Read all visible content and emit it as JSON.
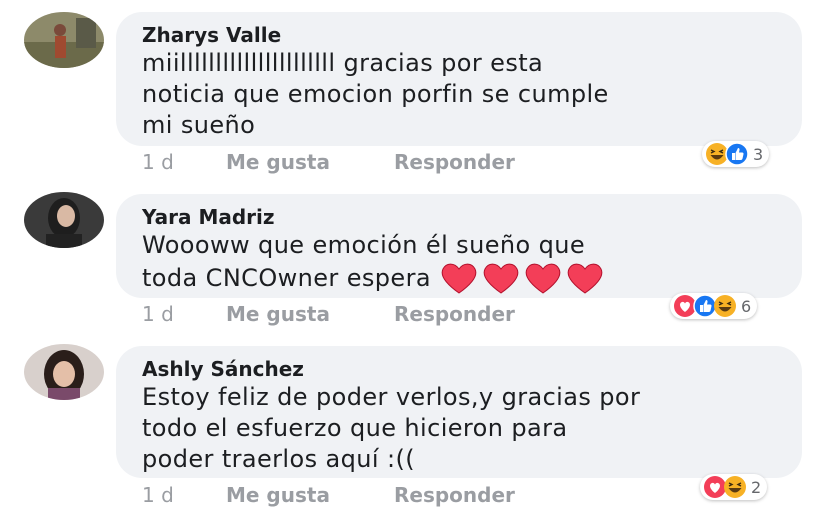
{
  "comments": [
    {
      "author": "Zharys Valle",
      "lines": [
        "miillllllllllllllllllllll gracias por esta",
        "noticia que emocion porfin se cumple",
        "mi sueño"
      ],
      "time": "1 d",
      "like_label": "Me gusta",
      "reply_label": "Responder",
      "reactions": [
        "haha",
        "like"
      ],
      "reaction_count": "3"
    },
    {
      "author": "Yara Madriz",
      "lines": [
        "Woooww que emoción él sueño que",
        "toda CNCOwner espera"
      ],
      "hearts": 4,
      "time": "1 d",
      "like_label": "Me gusta",
      "reply_label": "Responder",
      "reactions": [
        "love",
        "like",
        "haha"
      ],
      "reaction_count": "6"
    },
    {
      "author": "Ashly Sánchez",
      "lines": [
        "Estoy feliz de poder verlos,y gracias por",
        "todo el esfuerzo que hicieron para",
        "poder traerlos aquí :(("
      ],
      "time": "1 d",
      "like_label": "Me gusta",
      "reply_label": "Responder",
      "reactions": [
        "love",
        "haha"
      ],
      "reaction_count": "2"
    }
  ],
  "colors": {
    "bubble": "#f0f2f5",
    "meta_text": "#9a9da2",
    "like_blue": "#1877f2",
    "love_red": "#f33e58",
    "haha_yellow": "#f7b125"
  }
}
